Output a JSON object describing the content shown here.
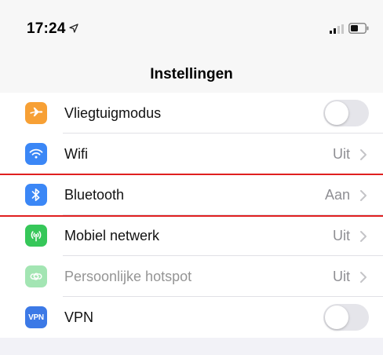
{
  "status_bar": {
    "time": "17:24",
    "location_icon": "location-arrow-icon",
    "signal_icon": "cellular-signal-icon",
    "battery_icon": "battery-icon"
  },
  "nav": {
    "title": "Instellingen"
  },
  "rows": [
    {
      "label": "Vliegtuigmodus",
      "icon": "airplane-icon",
      "icon_color": "#f7a035",
      "control": "toggle",
      "toggle_on": false
    },
    {
      "label": "Wifi",
      "icon": "wifi-icon",
      "icon_color": "#3b87f6",
      "control": "value",
      "value": "Uit"
    },
    {
      "label": "Bluetooth",
      "icon": "bluetooth-icon",
      "icon_color": "#3b87f6",
      "control": "value",
      "value": "Aan"
    },
    {
      "label": "Mobiel netwerk",
      "icon": "antenna-icon",
      "icon_color": "#36c759",
      "control": "value",
      "value": "Uit"
    },
    {
      "label": "Persoonlijke hotspot",
      "icon": "hotspot-icon",
      "icon_color": "#36c759",
      "control": "value",
      "value": "Uit",
      "dimmed": true
    },
    {
      "label": "VPN",
      "icon": "vpn-icon",
      "icon_color": "#3c79e6",
      "icon_text": "VPN",
      "control": "toggle",
      "toggle_on": false
    }
  ],
  "colors": {
    "annotation_red": "#e02020",
    "value_gray": "#8e8e93"
  }
}
